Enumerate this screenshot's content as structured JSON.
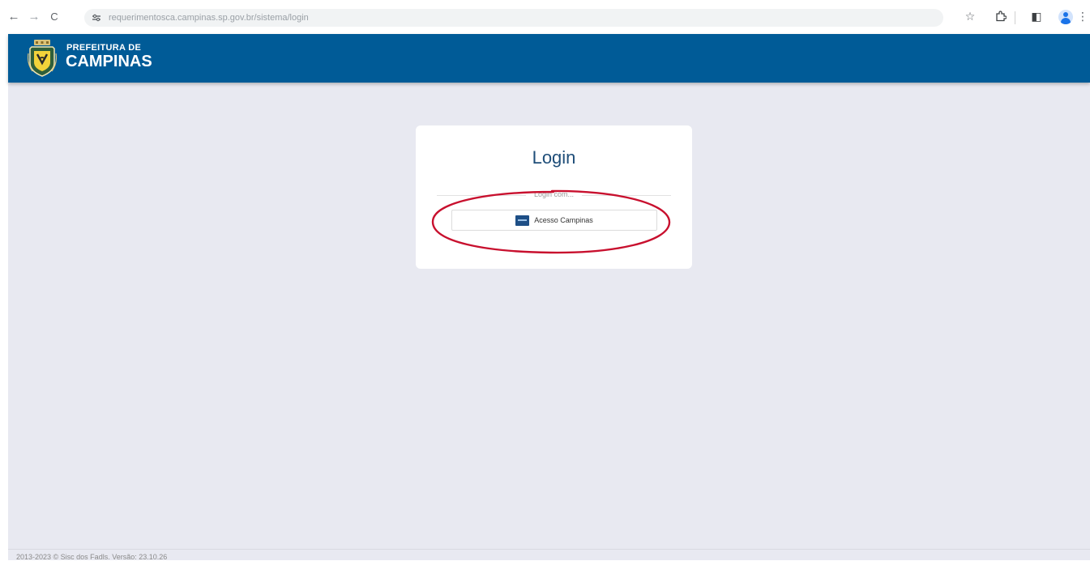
{
  "browser": {
    "back_icon": "←",
    "forward_icon": "→",
    "reload_icon": "C",
    "site_info_icon": "site-info-icon",
    "url": "requerimentosca.campinas.sp.gov.br/sistema/login",
    "bookmark_icon": "☆",
    "extensions_icon": "puzzle-icon",
    "sidepanel_icon": "◧",
    "menu_icon": "⋮"
  },
  "header": {
    "brand_line1": "PREFEITURA DE",
    "brand_line2": "CAMPINAS",
    "background_color": "#005b97"
  },
  "login": {
    "title": "Login",
    "divider_label": "Login com...",
    "sso_button_label": "Acesso Campinas",
    "highlight_color": "#c8102e"
  },
  "footer": {
    "text": "2013-2023 © Sisc dos Fadls. Versão: 23.10.26"
  }
}
